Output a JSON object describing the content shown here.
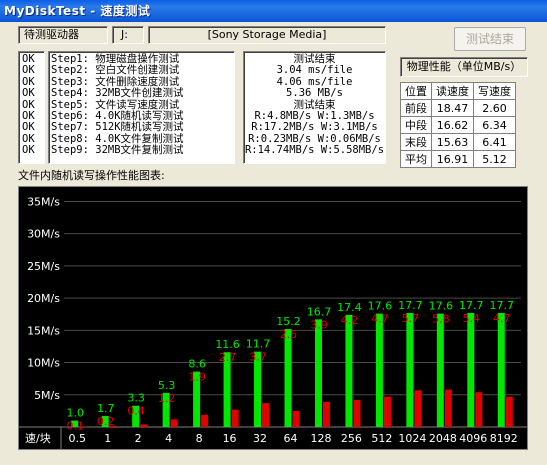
{
  "window": {
    "title": "MyDiskTest - 速度测试"
  },
  "drive": {
    "label": "待测驱动器",
    "letter": "J:",
    "name": "[Sony Storage Media]"
  },
  "end_button": {
    "label": "测试结束"
  },
  "steps": [
    {
      "status": "OK",
      "name": "Step1: 物理磁盘操作测试"
    },
    {
      "status": "OK",
      "name": "Step2: 空白文件创建测试"
    },
    {
      "status": "OK",
      "name": "Step3: 文件删除速度测试"
    },
    {
      "status": "OK",
      "name": "Step4: 32MB文件创建测试"
    },
    {
      "status": "OK",
      "name": "Step5: 文件读写速度测试"
    },
    {
      "status": "OK",
      "name": "Step6: 4.0K随机读写测试"
    },
    {
      "status": "OK",
      "name": "Step7: 512K随机读写测试"
    },
    {
      "status": "OK",
      "name": "Step8: 4.0K文件复制测试"
    },
    {
      "status": "OK",
      "name": "Step9: 32MB文件复制测试"
    }
  ],
  "results": [
    "测试结束",
    "3.04 ms/file",
    "4.06 ms/file",
    "5.36 MB/s",
    "测试结束",
    "R:4.8MB/s W:1.3MB/s",
    "R:17.2MB/s W:3.1MB/s",
    "R:0.23MB/s W:0.06MB/s",
    "R:14.74MB/s W:5.58MB/s"
  ],
  "perf": {
    "title": "物理性能（单位MB/s）",
    "headers": [
      "位置",
      "读速度",
      "写速度"
    ],
    "rows": [
      {
        "pos": "前段",
        "read": "18.47",
        "write": "2.60"
      },
      {
        "pos": "中段",
        "read": "16.62",
        "write": "6.34"
      },
      {
        "pos": "末段",
        "read": "15.63",
        "write": "6.41"
      },
      {
        "pos": "平均",
        "read": "16.91",
        "write": "5.12"
      }
    ]
  },
  "chart_label": "文件内随机读写操作性能图表:",
  "chart_data": {
    "type": "bar",
    "xlabel": "速/块",
    "categories": [
      "0.5",
      "1",
      "2",
      "4",
      "8",
      "16",
      "32",
      "64",
      "128",
      "256",
      "512",
      "1024",
      "2048",
      "4096",
      "8192"
    ],
    "series": [
      {
        "values": [
          1.0,
          1.7,
          3.3,
          5.3,
          8.6,
          11.6,
          11.7,
          15.2,
          16.7,
          17.4,
          17.6,
          17.7,
          17.6,
          17.7,
          17.7
        ],
        "labels": [
          "1.0",
          "1.7",
          "3.3",
          "5.3",
          "8.6",
          "11.6",
          "11.7",
          "15.2",
          "16.7",
          "17.4",
          "17.6",
          "17.7",
          "17.6",
          "17.7",
          "17.7"
        ],
        "color": "#00e800"
      },
      {
        "values": [
          0.1,
          0.2,
          0.4,
          1.2,
          1.9,
          2.7,
          3.7,
          2.5,
          3.9,
          4.2,
          4.7,
          5.7,
          5.8,
          5.4,
          4.7
        ],
        "labels": [
          "0.1",
          "0.2",
          "0.4",
          "1.2",
          "1.9",
          "2.7",
          "3.7",
          "2.5",
          "3.9",
          "4.2",
          "4.7",
          "5.7",
          "5.8",
          "5.4",
          "4.7"
        ],
        "color": "#e00000"
      }
    ],
    "yticks": [
      "5M/s",
      "10M/s",
      "15M/s",
      "20M/s",
      "25M/s",
      "30M/s",
      "35M/s"
    ],
    "ylim": [
      0,
      36
    ]
  }
}
